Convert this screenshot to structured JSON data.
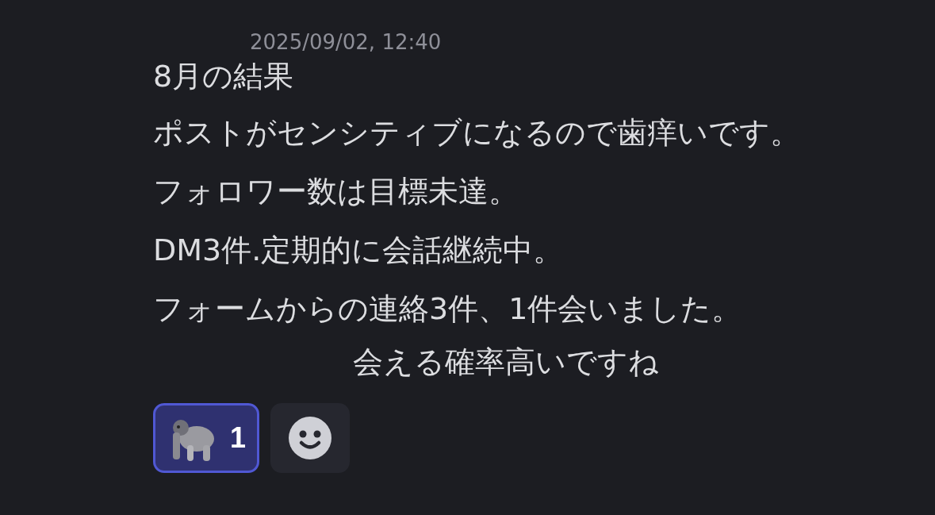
{
  "message": {
    "timestamp": "2025/09/02, 12:40",
    "lines": [
      {
        "kind": "plain",
        "text": "8月の結果"
      },
      {
        "kind": "plain",
        "text": "ポストがセンシティブになるので歯痒いです。"
      },
      {
        "kind": "plain",
        "text": "フォロワー数は目標未達。"
      },
      {
        "kind": "plain",
        "text": "DM3件.定期的に会話継続中。"
      },
      {
        "kind": "plain",
        "text": "フォームからの連絡3件、1件会いました。"
      },
      {
        "kind": "indented",
        "text": "会える確率高いですね"
      }
    ],
    "reactions": [
      {
        "kind": "emoji",
        "count": "1",
        "selected": true
      },
      {
        "kind": "add"
      }
    ]
  }
}
